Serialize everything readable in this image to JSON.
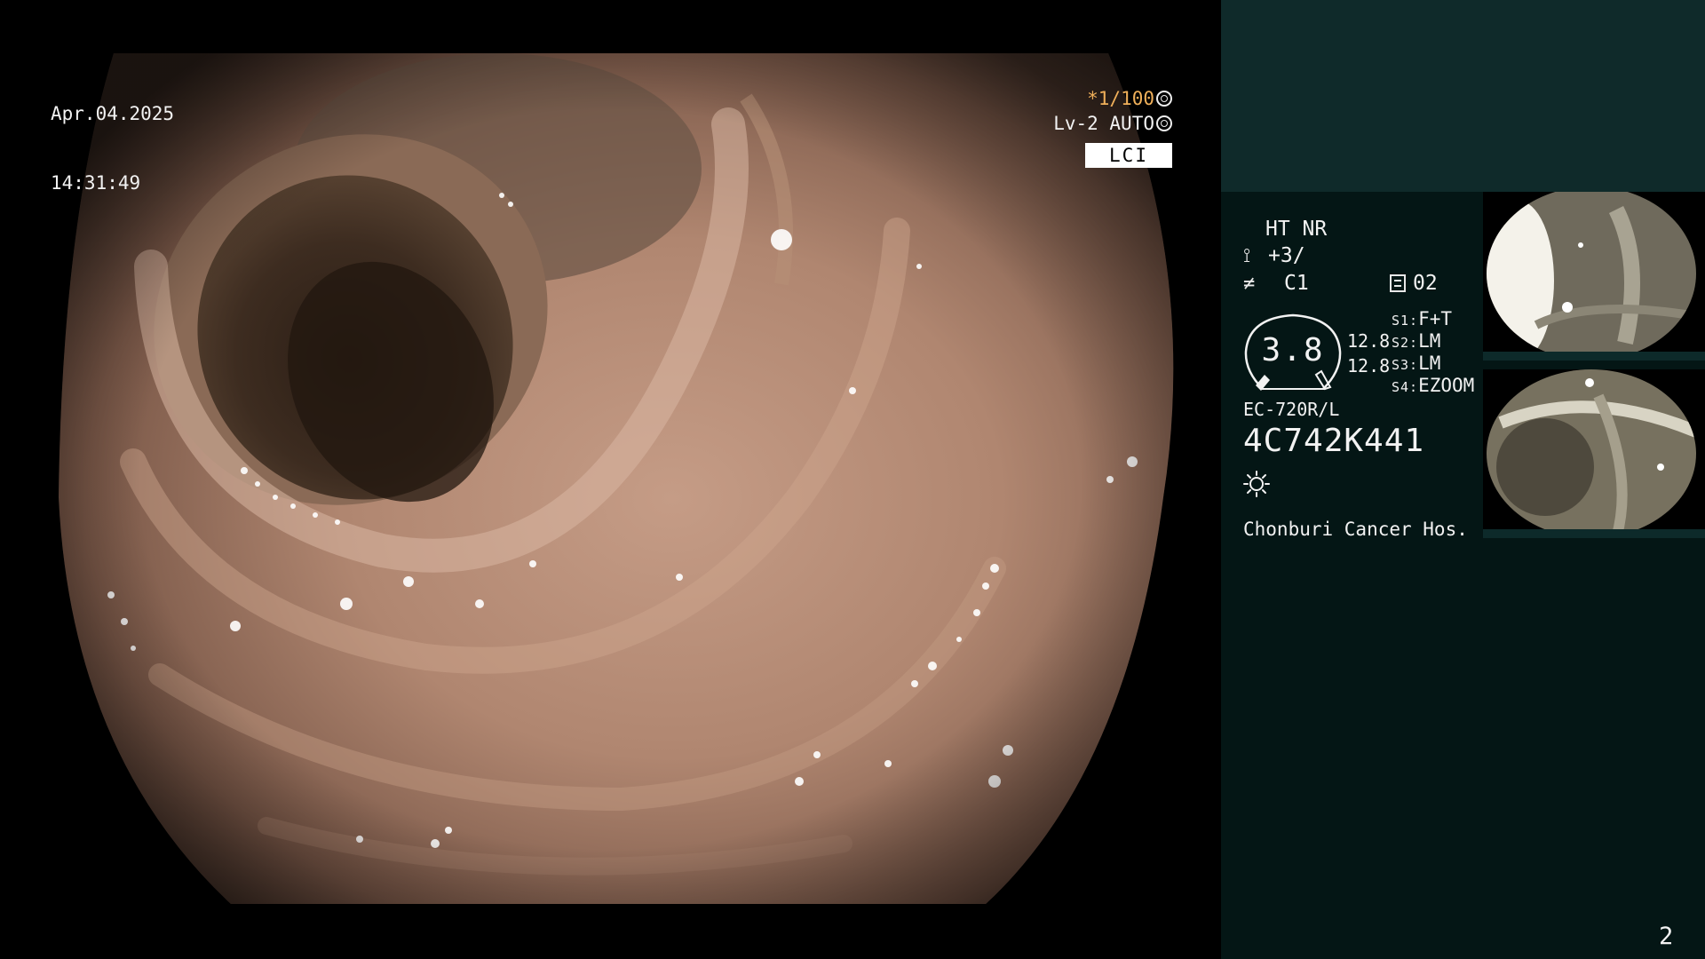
{
  "overlay": {
    "date": "Apr.04.2025",
    "time": "14:31:49",
    "shutter": "*1/100",
    "iris": "Lv-2 AUTO",
    "mode": "LCI"
  },
  "panel": {
    "ht_nr": "HT NR",
    "enhancement": "+3/",
    "color": "C1",
    "memory": "02",
    "gauge_value": "3.8",
    "gauge_r1": "12.8",
    "gauge_r2": "12.8",
    "switches": [
      {
        "key": "S1:",
        "value": "F+T"
      },
      {
        "key": "S2:",
        "value": "LM"
      },
      {
        "key": "S3:",
        "value": "LM"
      },
      {
        "key": "S4:",
        "value": "EZOOM"
      }
    ],
    "scope_model": "EC-720R/L",
    "scope_serial": "4C742K441",
    "hospital": "Chonburi Cancer Hos.",
    "page_number": "2"
  },
  "icons": {
    "shutter": "shutter-icon",
    "iris": "iris-icon",
    "enhancement": "enhancement-icon",
    "color": "color-icon",
    "memory": "memory-icon",
    "light": "light-icon"
  },
  "colors": {
    "panel_bg": "#041615",
    "panel_header": "#0f2a2a",
    "shutter_text": "#f0b05a",
    "mucosa": "#b38a72"
  }
}
